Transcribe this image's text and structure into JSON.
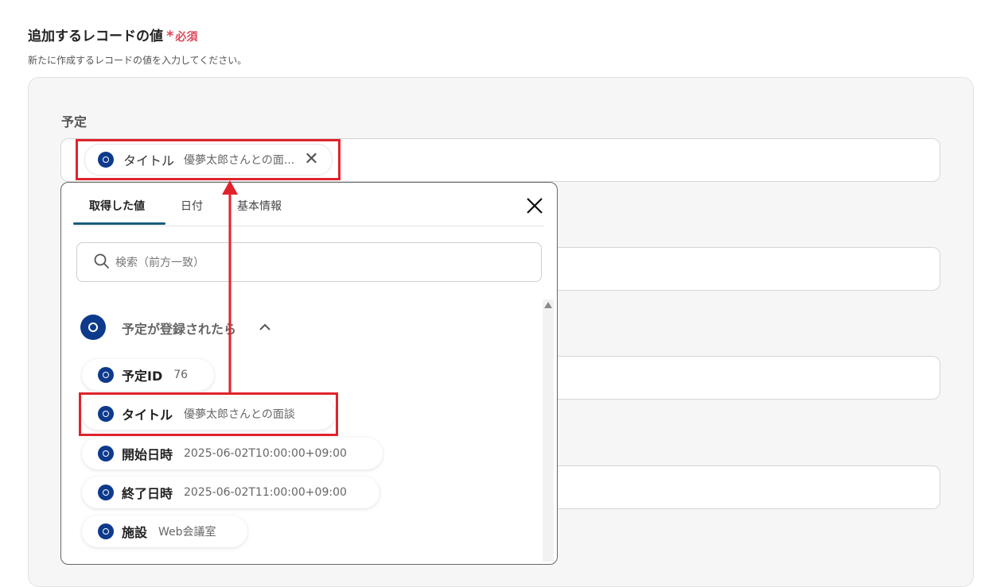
{
  "section": {
    "title": "追加するレコードの値",
    "required_star": "*",
    "required_label": "必須",
    "description": "新たに作成するレコードの値を入力してください。"
  },
  "field": {
    "label": "予定",
    "chip": {
      "label": "タイトル",
      "value": "優夢太郎さんとの面..."
    }
  },
  "popover": {
    "tabs": [
      {
        "label": "取得した値",
        "active": true
      },
      {
        "label": "日付",
        "active": false
      },
      {
        "label": "基本情報",
        "active": false
      }
    ],
    "search_placeholder": "検索（前方一致）",
    "group": {
      "title": "予定が登録されたら",
      "items": [
        {
          "label": "予定ID",
          "value": "76"
        },
        {
          "label": "タイトル",
          "value": "優夢太郎さんとの面談"
        },
        {
          "label": "開始日時",
          "value": "2025-06-02T10:00:00+09:00"
        },
        {
          "label": "終了日時",
          "value": "2025-06-02T11:00:00+09:00"
        },
        {
          "label": "施設",
          "value": "Web会議室"
        }
      ]
    }
  },
  "colors": {
    "required": "#e0475b",
    "app_icon": "#0d3a8c",
    "active_tab_underline": "#175a7c",
    "annotation": "#e0232b"
  }
}
